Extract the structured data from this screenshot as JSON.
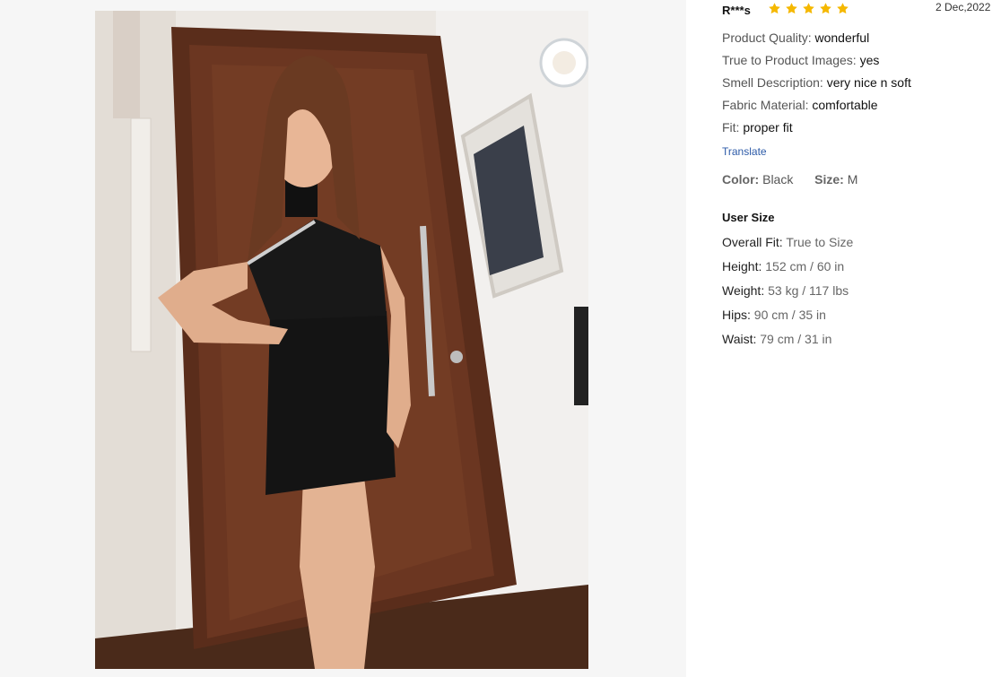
{
  "review": {
    "reviewer": "R***s",
    "rating": 5,
    "date": "2 Dec,2022",
    "star_color": "#f5b800",
    "attributes": [
      {
        "label": "Product Quality:",
        "value": "wonderful"
      },
      {
        "label": "True to Product Images:",
        "value": "yes"
      },
      {
        "label": "Smell Description:",
        "value": "very nice n soft"
      },
      {
        "label": "Fabric Material:",
        "value": "comfortable"
      },
      {
        "label": "Fit:",
        "value": "proper fit"
      }
    ],
    "translate_label": "Translate",
    "color_label": "Color:",
    "color_value": "Black",
    "size_label": "Size:",
    "size_value": "M"
  },
  "user_size": {
    "title": "User Size",
    "rows": [
      {
        "label": "Overall Fit:",
        "value": "True to Size"
      },
      {
        "label": "Height:",
        "value": "152 cm / 60 in"
      },
      {
        "label": "Weight:",
        "value": "53 kg / 117 lbs"
      },
      {
        "label": "Hips:",
        "value": "90 cm / 35 in"
      },
      {
        "label": "Waist:",
        "value": "79 cm / 31 in"
      }
    ]
  },
  "photo": {
    "icon": "review-photo"
  }
}
